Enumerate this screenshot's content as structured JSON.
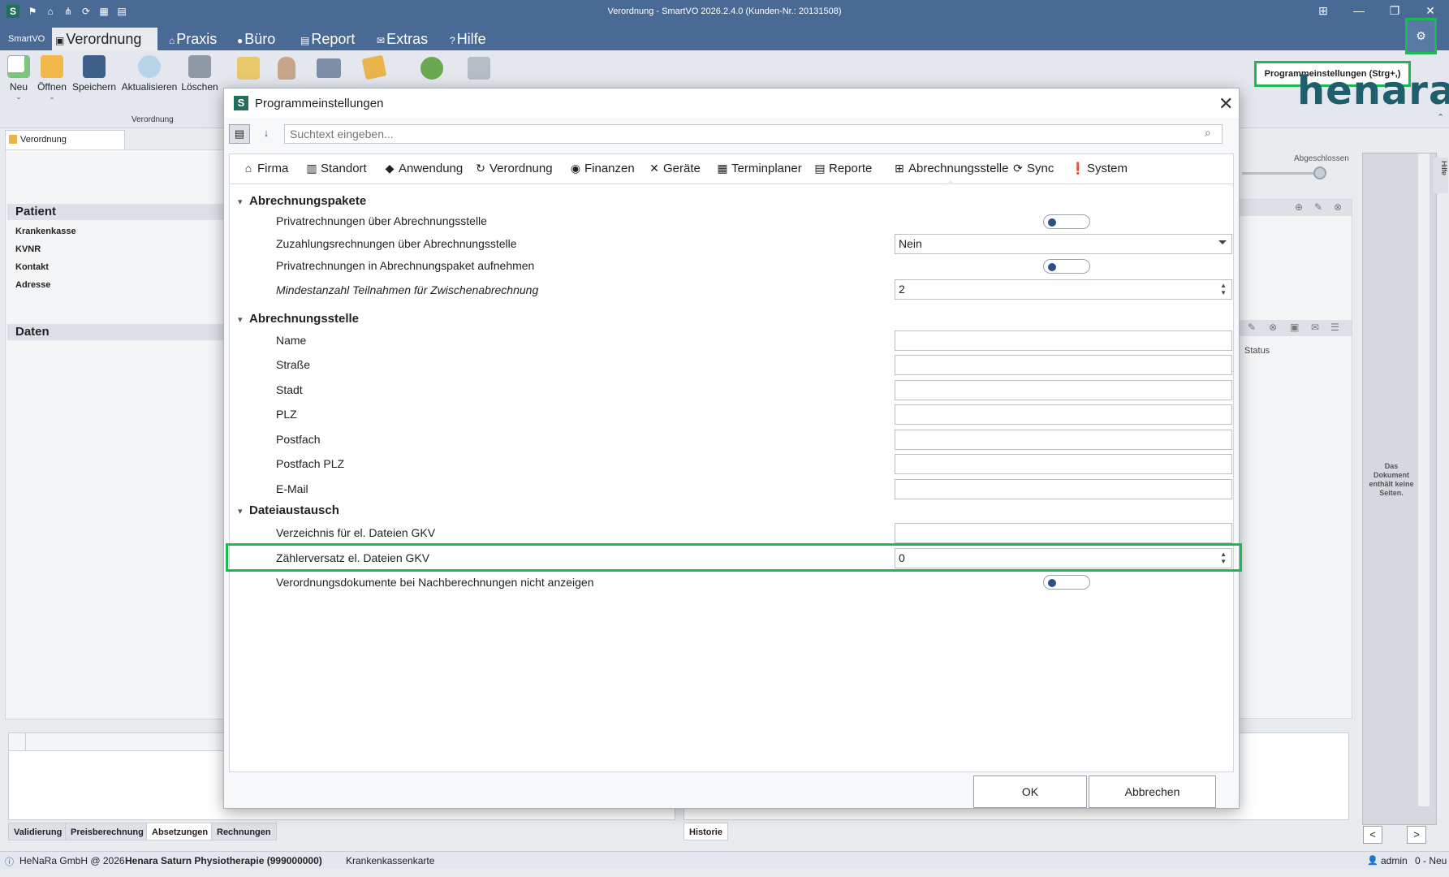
{
  "window": {
    "title": "Verordnung - SmartVO 2026.2.4.0 (Kunden-Nr.: 20131508)"
  },
  "menubar": {
    "app_label": "SmartVO",
    "tabs": [
      {
        "label": "Verordnung",
        "icon": "document-icon"
      },
      {
        "label": "Praxis",
        "icon": "house-icon"
      },
      {
        "label": "Büro",
        "icon": "coins-icon"
      },
      {
        "label": "Report",
        "icon": "report-icon"
      },
      {
        "label": "Extras",
        "icon": "extras-icon"
      },
      {
        "label": "Hilfe",
        "icon": "question-icon"
      }
    ]
  },
  "ribbon": {
    "buttons": [
      {
        "label": "Neu",
        "icon": "new-document-icon"
      },
      {
        "label": "Öffnen",
        "icon": "folder-icon"
      },
      {
        "label": "Speichern",
        "icon": "save-icon"
      },
      {
        "label": "Aktualisieren",
        "icon": "refresh-icon"
      },
      {
        "label": "Löschen",
        "icon": "trash-icon"
      }
    ],
    "group_label": "Verordnung"
  },
  "doc_tab": {
    "label": "Verordnung"
  },
  "slider": {
    "value": "0",
    "right_label": "Abgeschlossen"
  },
  "left_panel": {
    "patient_header": "Patient",
    "items": [
      "Krankenkasse",
      "KVNR",
      "Kontakt",
      "Adresse"
    ],
    "daten_header": "Daten"
  },
  "right_panel": {
    "status_header": "Status"
  },
  "pdf_panel": {
    "message": "Das Dokument enthält keine Seiten.",
    "side_tab": "Hilfe"
  },
  "bottom_tabs": {
    "left": [
      "Validierung",
      "Preisberechnung",
      "Absetzungen",
      "Rechnungen"
    ],
    "right": [
      "Historie"
    ]
  },
  "statusbar": {
    "copyright": "HeNaRa GmbH @ 2026",
    "practice": "Henara Saturn Physiotherapie (999000000)",
    "card": "Krankenkassenkarte",
    "user": "admin",
    "state": "0 - Neu"
  },
  "logo": {
    "text": "henara"
  },
  "tooltip": {
    "text": "Programmeinstellungen (Strg+,)"
  },
  "dialog": {
    "title": "Programmeinstellungen",
    "search_placeholder": "Suchtext eingeben...",
    "categories": [
      {
        "label": "Firma",
        "icon": "home-icon"
      },
      {
        "label": "Standort",
        "icon": "building-icon"
      },
      {
        "label": "Anwendung",
        "icon": "box-icon"
      },
      {
        "label": "Verordnung",
        "icon": "prescription-icon"
      },
      {
        "label": "Finanzen",
        "icon": "coins-icon"
      },
      {
        "label": "Geräte",
        "icon": "tools-icon"
      },
      {
        "label": "Terminplaner",
        "icon": "calendar-icon"
      },
      {
        "label": "Reporte",
        "icon": "report-icon"
      },
      {
        "label": "Abrechnungsstelle",
        "icon": "grid-icon"
      },
      {
        "label": "Sync",
        "icon": "sync-icon"
      },
      {
        "label": "System",
        "icon": "warning-icon"
      }
    ],
    "groups": {
      "abrechnungspakete": {
        "title": "Abrechnungspakete",
        "rows": {
          "privat": {
            "label": "Privatrechnungen über Abrechnungsstelle",
            "value": false
          },
          "zuzahlung": {
            "label": "Zuzahlungsrechnungen über Abrechnungsstelle",
            "value": "Nein"
          },
          "paket": {
            "label": "Privatrechnungen in Abrechnungspaket aufnehmen",
            "value": false
          },
          "mindest": {
            "label": "Mindestanzahl Teilnahmen für Zwischenabrechnung",
            "value": "2"
          }
        }
      },
      "abrechnungsstelle": {
        "title": "Abrechnungsstelle",
        "rows": [
          "Name",
          "Straße",
          "Stadt",
          "PLZ",
          "Postfach",
          "Postfach PLZ",
          "E-Mail"
        ]
      },
      "dateiaustausch": {
        "title": "Dateiaustausch",
        "rows": {
          "verzeichnis": {
            "label": "Verzeichnis für el. Dateien GKV",
            "value": ""
          },
          "zaehler": {
            "label": "Zählerversatz el. Dateien GKV",
            "value": "0"
          },
          "nachberechnung": {
            "label": "Verordnungsdokumente bei Nachberechnungen nicht anzeigen",
            "value": false
          }
        }
      }
    },
    "ok_label": "OK",
    "cancel_label": "Abbrechen"
  },
  "colors": {
    "titlebar": "#4a6a96",
    "highlight": "#1db954",
    "toggle_knob": "#2d4f86",
    "logo": "#1f5f6b"
  }
}
